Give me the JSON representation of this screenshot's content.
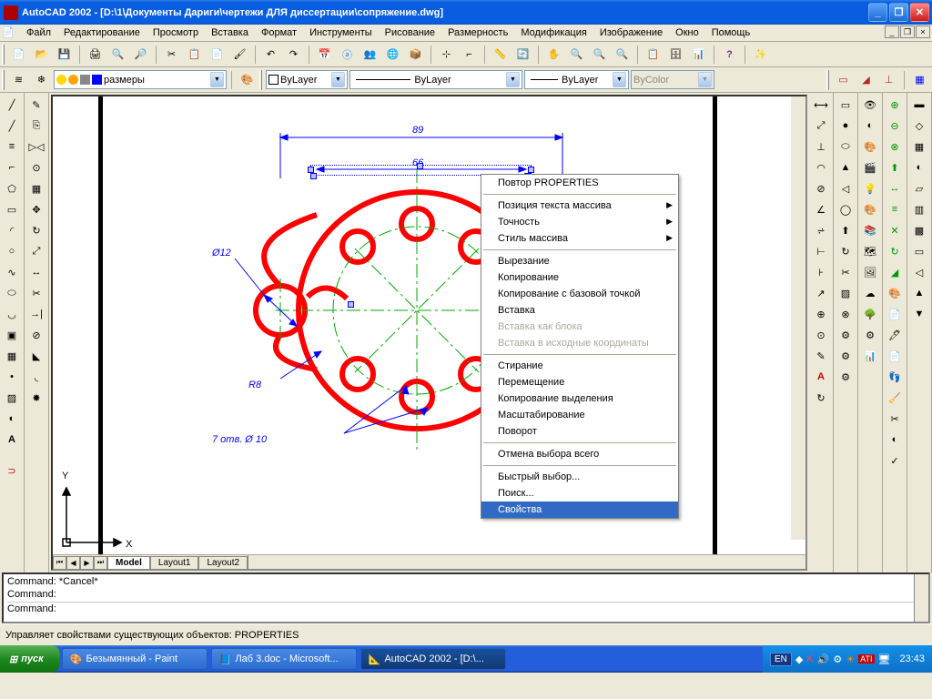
{
  "titlebar": {
    "text": "AutoCAD 2002 - [D:\\1\\Документы Дариги\\чертежи ДЛЯ диссертации\\сопряжение.dwg]"
  },
  "menubar": {
    "items": [
      "Файл",
      "Редактирование",
      "Просмотр",
      "Вставка",
      "Формат",
      "Инструменты",
      "Рисование",
      "Размерность",
      "Модификация",
      "Изображение",
      "Окно",
      "Помощь"
    ]
  },
  "layer_combo": {
    "text": "размеры"
  },
  "color_combo": {
    "text": "ByLayer"
  },
  "linetype_combo": {
    "text": "ByLayer"
  },
  "lineweight_combo": {
    "text": "ByLayer"
  },
  "plotcolor_combo": {
    "text": "ByColor"
  },
  "tabs": {
    "model": "Model",
    "l1": "Layout1",
    "l2": "Layout2"
  },
  "cmdwin": {
    "line1": "Command: *Cancel*",
    "line2": "Command:",
    "line3": "Command:"
  },
  "statusbar": {
    "text": "Управляет свойствами существующих объектов: PROPERTIES"
  },
  "context": {
    "repeat": "Повтор PROPERTIES",
    "pos": "Позиция текста массива",
    "prec": "Точность",
    "style": "Стиль массива",
    "cut": "Вырезание",
    "copy": "Копирование",
    "copybase": "Копирование с базовой точкой",
    "paste": "Вставка",
    "pasteblock": "Вставка как блока",
    "pasteorig": "Вставка в исходные координаты",
    "erase": "Стирание",
    "move": "Перемещение",
    "copysel": "Копирование выделения",
    "scale": "Масштабирование",
    "rotate": "Поворот",
    "deselect": "Отмена выбора всего",
    "qselect": "Быстрый выбор...",
    "find": "Поиск...",
    "props": "Свойства"
  },
  "drawing": {
    "dim1": "89",
    "dim2": "66",
    "dim_dia": "Ø12",
    "dim_r": "R8",
    "note": "7 отв. Ø 10",
    "axis_x": "X",
    "axis_y": "Y"
  },
  "taskbar": {
    "start": "пуск",
    "task1": "Безымянный - Paint",
    "task2": "Лаб 3.doc - Microsoft...",
    "task3": "AutoCAD 2002 - [D:\\...",
    "lang": "EN",
    "time": "23:43"
  }
}
